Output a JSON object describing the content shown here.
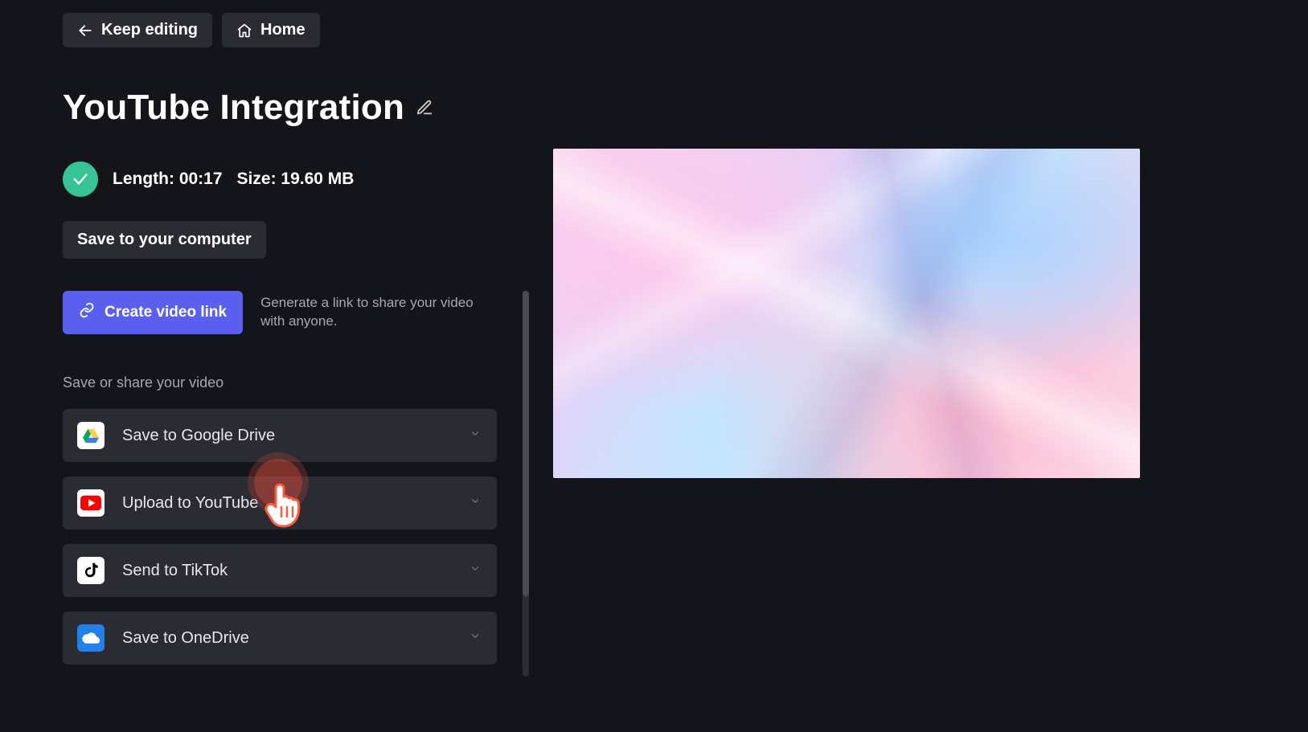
{
  "topbar": {
    "keep_editing": "Keep editing",
    "home": "Home"
  },
  "title": "YouTube Integration",
  "status": {
    "length_label": "Length:",
    "length_value": "00:17",
    "size_label": "Size:",
    "size_value": "19.60 MB"
  },
  "save_local": "Save to your computer",
  "link": {
    "button": "Create video link",
    "description": "Generate a link to share your video with anyone."
  },
  "section_label": "Save or share your video",
  "share": [
    {
      "id": "google-drive",
      "label": "Save to Google Drive"
    },
    {
      "id": "youtube",
      "label": "Upload to YouTube"
    },
    {
      "id": "tiktok",
      "label": "Send to TikTok"
    },
    {
      "id": "onedrive",
      "label": "Save to OneDrive"
    }
  ],
  "colors": {
    "accent": "#5b5fef",
    "success": "#36c395",
    "panel": "#2a2b33",
    "bg": "#14151b"
  }
}
